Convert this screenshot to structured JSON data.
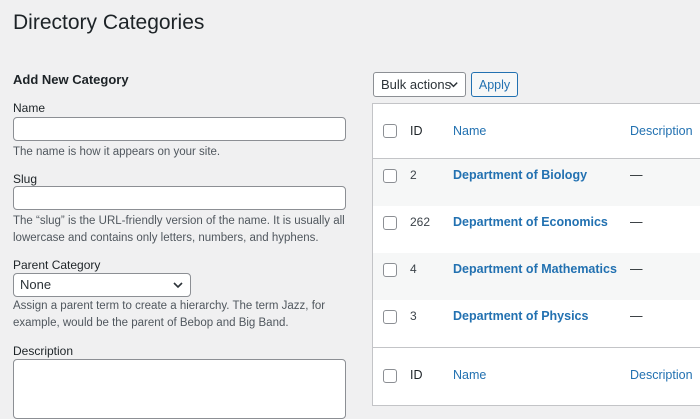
{
  "page": {
    "title": "Directory Categories"
  },
  "form": {
    "heading": "Add New Category",
    "name_label": "Name",
    "name_value": "",
    "name_help": "The name is how it appears on your site.",
    "slug_label": "Slug",
    "slug_value": "",
    "slug_help": "The “slug” is the URL-friendly version of the name. It is usually all lowercase and contains only letters, numbers, and hyphens.",
    "parent_label": "Parent Category",
    "parent_value": "None",
    "parent_help": "Assign a parent term to create a hierarchy. The term Jazz, for example, would be the parent of Bebop and Big Band.",
    "description_label": "Description",
    "description_value": ""
  },
  "toolbar": {
    "bulk_actions": "Bulk actions",
    "apply": "Apply"
  },
  "table": {
    "columns": {
      "id": "ID",
      "name": "Name",
      "description": "Description"
    },
    "rows": [
      {
        "id": "2",
        "name": "Department of Biology",
        "description": "—"
      },
      {
        "id": "262",
        "name": "Department of Economics",
        "description": "—"
      },
      {
        "id": "4",
        "name": "Department of Mathematics",
        "description": "—"
      },
      {
        "id": "3",
        "name": "Department of Physics",
        "description": "—"
      }
    ]
  },
  "icons": {
    "select_arrow": "chevron-down-icon",
    "checkbox": "checkbox-icon"
  },
  "colors": {
    "link": "#2271b1",
    "background": "#f0f0f1",
    "border": "#c3c4c7"
  }
}
